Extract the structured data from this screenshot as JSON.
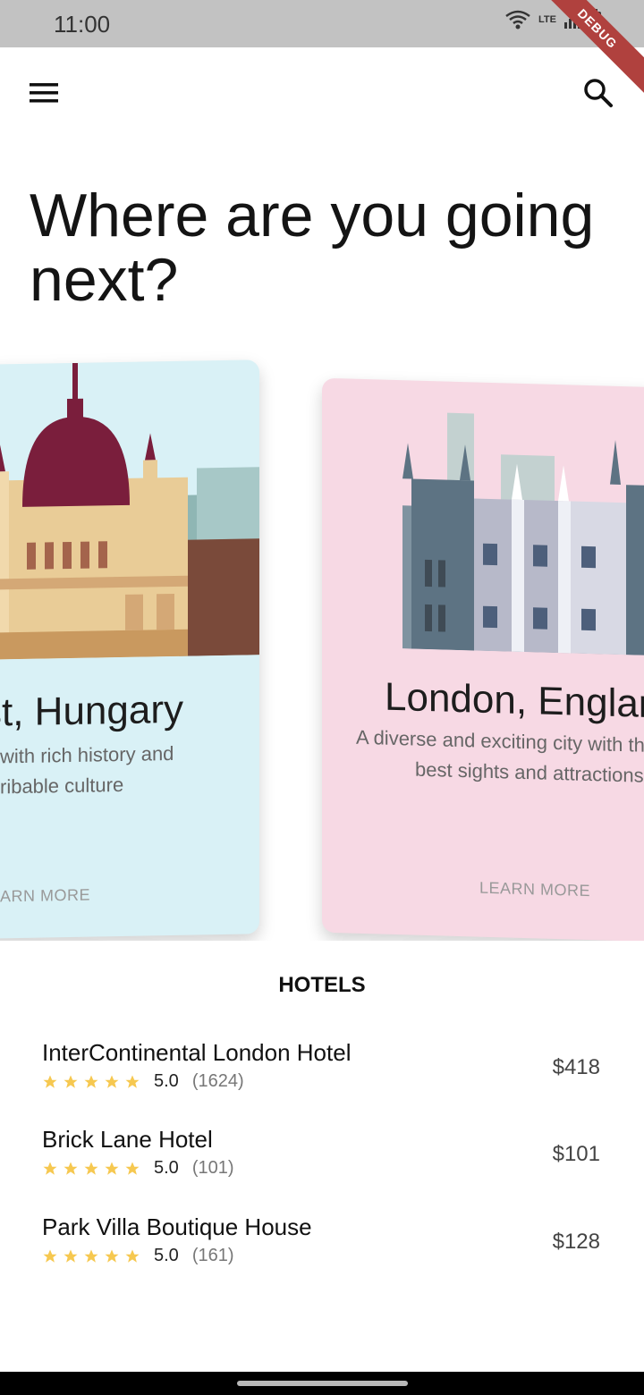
{
  "status_bar": {
    "time": "11:00",
    "network": "LTE",
    "debug_banner": "DEBUG"
  },
  "headline": "Where are you going next?",
  "cards": [
    {
      "title": "st, Hungary",
      "description_line1": "with rich history and",
      "description_line2": "ribable culture",
      "link": "ARN MORE",
      "background": "#d9f1f6"
    },
    {
      "title": "London, Englar",
      "description_line1": "A diverse and exciting city with the",
      "description_line2": "best sights and attractions",
      "link": "LEARN MORE",
      "background": "#f7d9e4"
    }
  ],
  "hotels_section": {
    "title": "HOTELS",
    "items": [
      {
        "name": "InterContinental London Hotel",
        "rating": "5.0",
        "reviews": "(1624)",
        "price": "$418"
      },
      {
        "name": "Brick Lane Hotel",
        "rating": "5.0",
        "reviews": "(101)",
        "price": "$101"
      },
      {
        "name": "Park Villa Boutique House",
        "rating": "5.0",
        "reviews": "(161)",
        "price": "$128"
      }
    ]
  },
  "icons": {
    "menu": "menu-icon",
    "search": "search-icon",
    "star": "star-icon",
    "wifi": "wifi-icon",
    "signal": "signal-icon",
    "battery": "battery-icon"
  },
  "colors": {
    "star": "#f6c850",
    "status_bar": "#c2c2c2",
    "debug": "#b0413e"
  }
}
